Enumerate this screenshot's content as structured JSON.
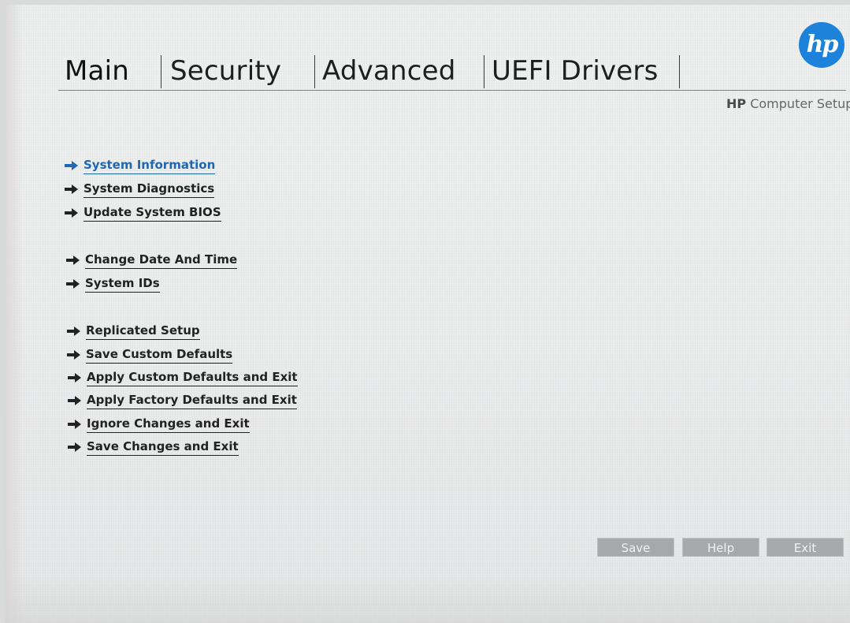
{
  "header": {
    "tabs": [
      {
        "label": "Main",
        "active": true
      },
      {
        "label": "Security",
        "active": false
      },
      {
        "label": "Advanced",
        "active": false
      },
      {
        "label": "UEFI Drivers",
        "active": false
      }
    ],
    "logo_text": "hp",
    "brand": "HP",
    "title": "Computer Setup"
  },
  "menu": {
    "items": [
      {
        "label": "System Information",
        "selected": true
      },
      {
        "label": "System Diagnostics"
      },
      {
        "label": "Update System BIOS"
      },
      {
        "label": "Change Date And Time"
      },
      {
        "label": "System IDs"
      },
      {
        "label": "Replicated Setup"
      },
      {
        "label": "Save Custom Defaults"
      },
      {
        "label": "Apply Custom Defaults and Exit"
      },
      {
        "label": "Apply Factory Defaults and Exit"
      },
      {
        "label": "Ignore Changes and Exit"
      },
      {
        "label": "Save Changes and Exit"
      }
    ]
  },
  "buttons": {
    "save": "Save",
    "help": "Help",
    "exit": "Exit"
  },
  "colors": {
    "background": "#eceded",
    "accent": "#1f67b3",
    "logo": "#1d82d9",
    "button": "#a6a8aa"
  },
  "icons": {
    "menu_arrow": "right-arrow-icon",
    "logo": "hp-logo-icon"
  }
}
